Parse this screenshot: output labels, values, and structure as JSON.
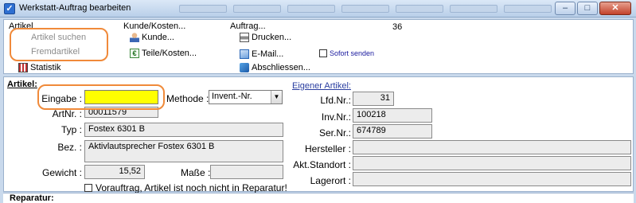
{
  "window": {
    "title": "Werkstatt-Auftrag bearbeiten",
    "buttons": {
      "minimize": "–",
      "maximize": "□",
      "close": "✕"
    }
  },
  "ribbon": {
    "artikel": {
      "label": "Artikel",
      "suchen": "Artikel suchen",
      "fremd": "Fremdartikel",
      "statistik": "Statistik"
    },
    "kunde": {
      "label": "Kunde/Kosten...",
      "kunde": "Kunde...",
      "teile": "Teile/Kosten..."
    },
    "auftrag": {
      "label": "Auftrag...",
      "number": "36",
      "drucken": "Drucken...",
      "email": "E-Mail...",
      "abschliessen": "Abschliessen...",
      "sofort": "Sofort senden"
    }
  },
  "form": {
    "section_label": "Artikel:",
    "eingabe_label": "Eingabe :",
    "eingabe_value": "",
    "methode_label": "Methode :",
    "methode_value": "Invent.-Nr.",
    "artnr_label": "ArtNr. :",
    "artnr_value": "00011579",
    "typ_label": "Typ :",
    "typ_value": "Fostex 6301 B",
    "bez_label": "Bez. :",
    "bez_value": "Aktivlautsprecher Fostex 6301 B",
    "gewicht_label": "Gewicht :",
    "gewicht_value": "15,52",
    "masse_label": "Maße :",
    "masse_value": "",
    "vorauftrag_label": "Vorauftrag, Artikel ist noch nicht in Reparatur!",
    "eigener_label": "Eigener Artikel:",
    "lfdnr_label": "Lfd.Nr.:",
    "lfdnr_value": "31",
    "invnr_label": "Inv.Nr.:",
    "invnr_value": "100218",
    "sernr_label": "Ser.Nr.:",
    "sernr_value": "674789",
    "hersteller_label": "Hersteller :",
    "hersteller_value": "",
    "standort_label": "Akt.Standort :",
    "standort_value": "",
    "lagerort_label": "Lagerort :",
    "lagerort_value": ""
  },
  "bottom": {
    "reparatur_label": "Reparatur:"
  }
}
